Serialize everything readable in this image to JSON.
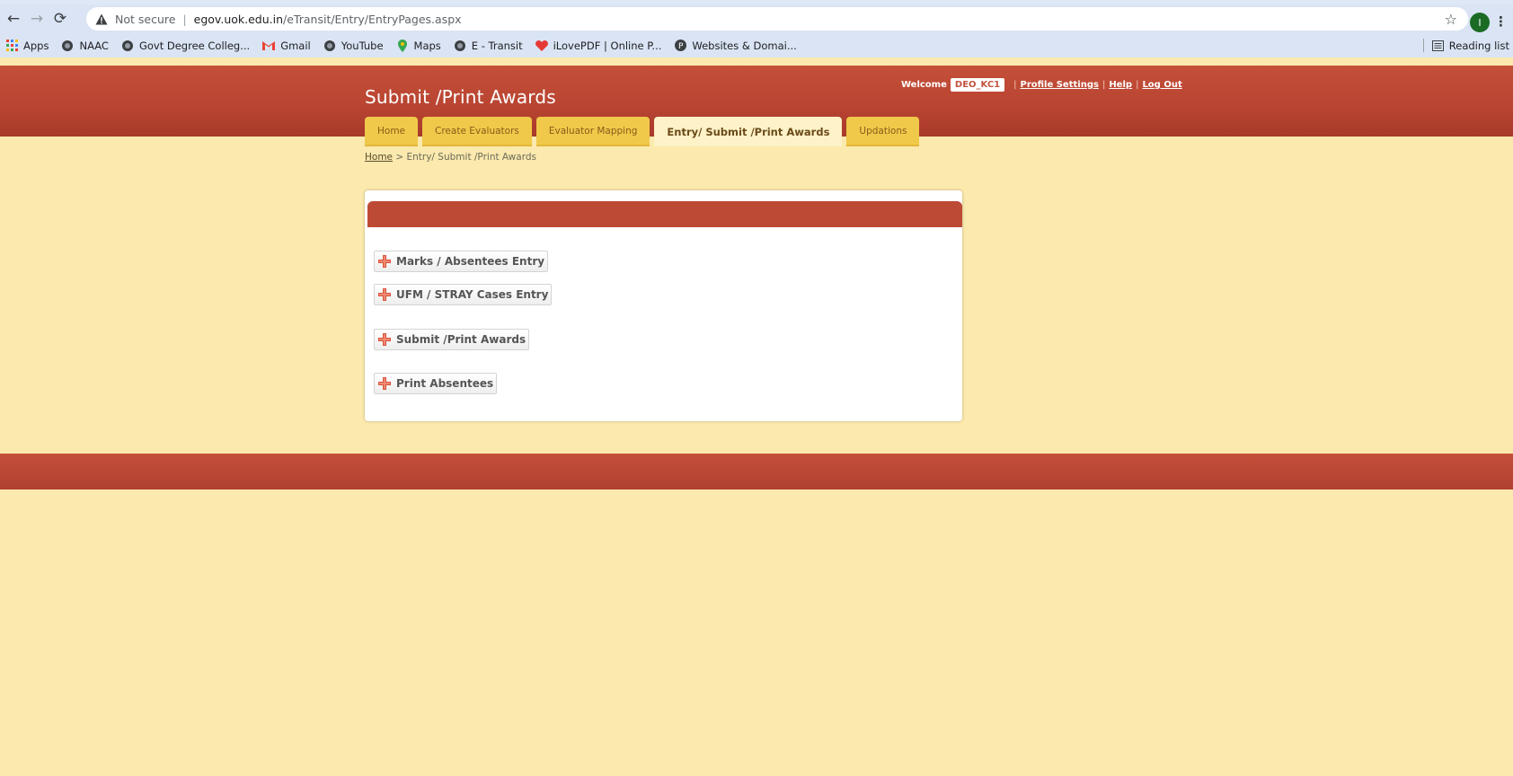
{
  "browser": {
    "security_label": "Not secure",
    "url_host": "egov.uok.edu.in",
    "url_path": "/eTransit/Entry/EntryPages.aspx",
    "profile_initial": "I",
    "reading_list_label": "Reading list",
    "bookmarks": [
      {
        "label": "Apps",
        "icon": "apps-grid-icon"
      },
      {
        "label": "NAAC",
        "icon": "globe-icon"
      },
      {
        "label": "Govt Degree Colleg...",
        "icon": "globe-icon"
      },
      {
        "label": "Gmail",
        "icon": "gmail-icon"
      },
      {
        "label": "YouTube",
        "icon": "globe-icon"
      },
      {
        "label": "Maps",
        "icon": "maps-pin-icon"
      },
      {
        "label": "E - Transit",
        "icon": "globe-icon"
      },
      {
        "label": "iLovePDF | Online P...",
        "icon": "ilovepdf-heart-icon"
      },
      {
        "label": "Websites & Domai...",
        "icon": "p-circle-icon"
      }
    ]
  },
  "header": {
    "title": "Submit /Print Awards",
    "welcome_label": "Welcome",
    "username": "DEO_KC1",
    "links": {
      "profile_settings": "Profile Settings",
      "help": "Help",
      "logout": "Log Out"
    },
    "separator": "|"
  },
  "tabs": [
    {
      "label": "Home",
      "active": false
    },
    {
      "label": "Create Evaluators",
      "active": false
    },
    {
      "label": "Evaluator Mapping",
      "active": false
    },
    {
      "label": "Entry/ Submit /Print Awards",
      "active": true
    },
    {
      "label": "Updations",
      "active": false
    }
  ],
  "breadcrumb": {
    "home": "Home",
    "separator": " > ",
    "current": "Entry/ Submit /Print Awards"
  },
  "panel": {
    "items": [
      {
        "label": "Marks / Absentees Entry"
      },
      {
        "label": "UFM / STRAY Cases Entry"
      },
      {
        "label": "Submit /Print Awards"
      },
      {
        "label": "Print Absentees"
      }
    ]
  },
  "colors": {
    "header_red": "#b84431",
    "page_bg": "#fbe9ad",
    "tab_yellow": "#f0c94a",
    "active_tab": "#fdf2c8"
  }
}
